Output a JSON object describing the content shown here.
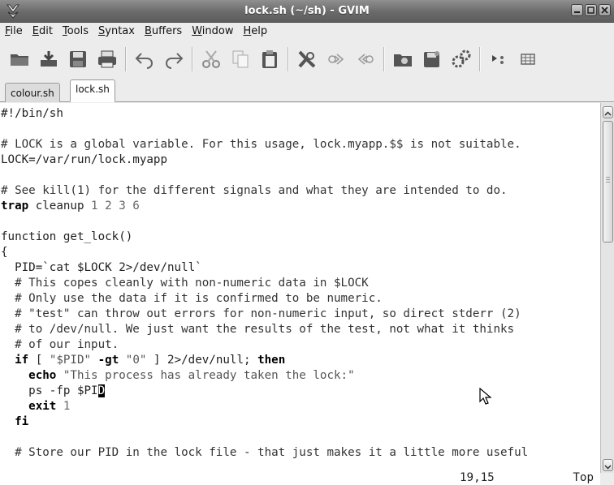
{
  "window": {
    "title": "lock.sh (~/sh) - GVIM"
  },
  "menu": [
    {
      "mn": "F",
      "rest": "ile"
    },
    {
      "mn": "E",
      "rest": "dit"
    },
    {
      "mn": "T",
      "rest": "ools"
    },
    {
      "mn": "S",
      "rest": "yntax"
    },
    {
      "mn": "B",
      "rest": "uffers"
    },
    {
      "mn": "W",
      "rest": "indow"
    },
    {
      "mn": "H",
      "rest": "elp"
    }
  ],
  "toolbar": [
    "open-file-icon",
    "save-icon",
    "save-all-icon",
    "print-icon",
    "undo-icon",
    "redo-icon",
    "cut-icon",
    "copy-icon",
    "paste-icon",
    "find-replace-icon",
    "find-next-icon",
    "find-previous-icon",
    "load-session-icon",
    "save-session-icon",
    "run-script-icon",
    "make-icon",
    "table-icon"
  ],
  "tabs": [
    {
      "label": "colour.sh",
      "active": false
    },
    {
      "label": "lock.sh",
      "active": true
    }
  ],
  "editor": {
    "lines": [
      [
        [
          "plain",
          "#!/bin/sh"
        ]
      ],
      [],
      [
        [
          "comment",
          "# LOCK is a global variable. For this usage, lock.myapp.$$ is not suitable."
        ]
      ],
      [
        [
          "plain",
          "LOCK=/var/run/lock.myapp"
        ]
      ],
      [],
      [
        [
          "comment",
          "# See kill(1) for the different signals and what they are intended to do."
        ]
      ],
      [
        [
          "kw",
          "trap"
        ],
        [
          "plain",
          " cleanup "
        ],
        [
          "num",
          "1 2 3 6"
        ]
      ],
      [],
      [
        [
          "plain",
          "function get_lock()"
        ]
      ],
      [
        [
          "plain",
          "{"
        ]
      ],
      [
        [
          "plain",
          "  PID=`cat $LOCK 2>/dev/null`"
        ]
      ],
      [
        [
          "comment",
          "  # This copes cleanly with non-numeric data in $LOCK"
        ]
      ],
      [
        [
          "comment",
          "  # Only use the data if it is confirmed to be numeric."
        ]
      ],
      [
        [
          "comment",
          "  # \"test\" can throw out errors for non-numeric input, so direct stderr (2)"
        ]
      ],
      [
        [
          "comment",
          "  # to /dev/null. We just want the results of the test, not what it thinks"
        ]
      ],
      [
        [
          "comment",
          "  # of our input."
        ]
      ],
      [
        [
          "plain",
          "  "
        ],
        [
          "kw",
          "if"
        ],
        [
          "plain",
          " [ "
        ],
        [
          "str",
          "\"$PID\""
        ],
        [
          "plain",
          " "
        ],
        [
          "kw",
          "-gt"
        ],
        [
          "plain",
          " "
        ],
        [
          "str",
          "\"0\""
        ],
        [
          "plain",
          " ] 2>/dev/null; "
        ],
        [
          "kw",
          "then"
        ]
      ],
      [
        [
          "plain",
          "    "
        ],
        [
          "kw",
          "echo"
        ],
        [
          "plain",
          " "
        ],
        [
          "str",
          "\"This process has already taken the lock:\""
        ]
      ],
      [
        [
          "plain",
          "    ps -fp $PI"
        ],
        [
          "cursor",
          "D"
        ]
      ],
      [
        [
          "plain",
          "    "
        ],
        [
          "kw",
          "exit"
        ],
        [
          "plain",
          " "
        ],
        [
          "num",
          "1"
        ]
      ],
      [
        [
          "plain",
          "  "
        ],
        [
          "kw",
          "fi"
        ]
      ],
      [],
      [
        [
          "comment",
          "  # Store our PID in the lock file - that just makes it a little more useful"
        ]
      ]
    ],
    "cursor_position": "19,15",
    "scroll_position": "Top"
  }
}
